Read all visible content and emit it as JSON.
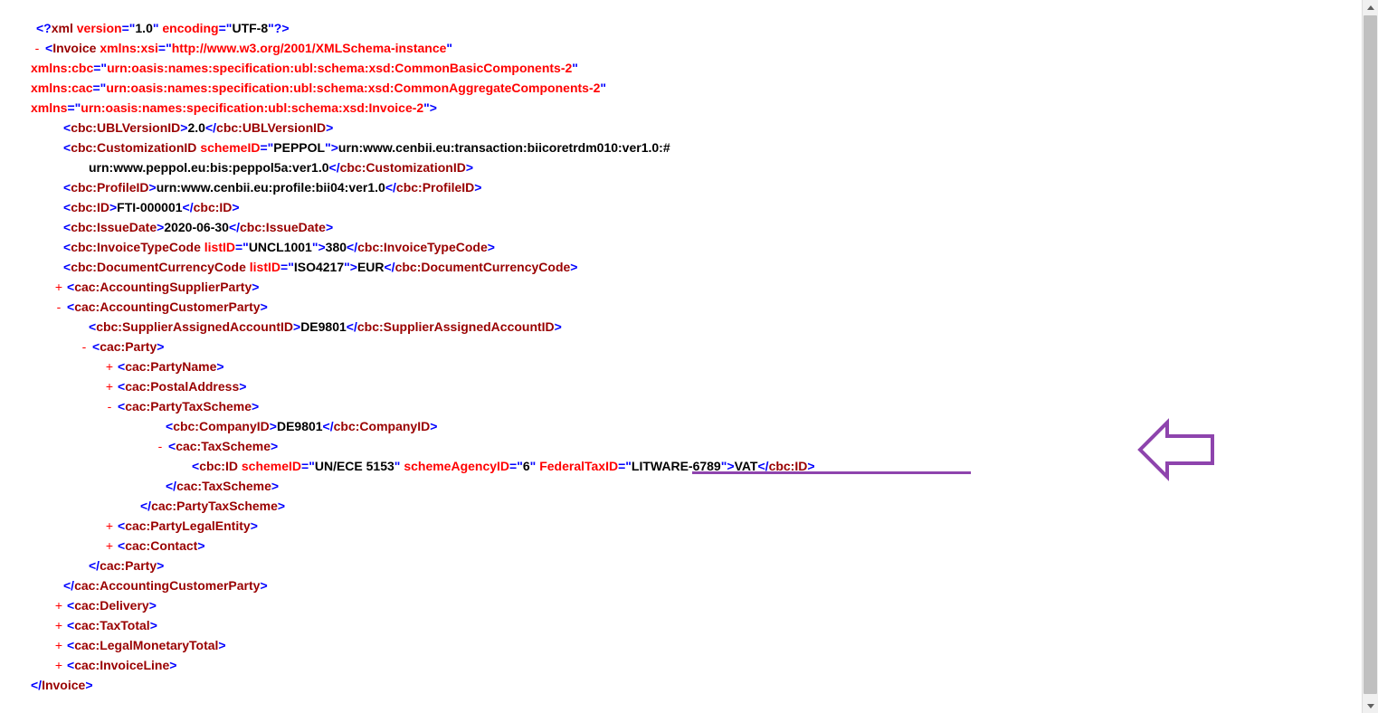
{
  "xmldecl": {
    "version": "1.0",
    "encoding": "UTF-8"
  },
  "root": {
    "name": "Invoice",
    "ns": {
      "xsi": "http://www.w3.org/2001/XMLSchema-instance",
      "cbc": "urn:oasis:names:specification:ubl:schema:xsd:CommonBasicComponents-2",
      "cac": "urn:oasis:names:specification:ubl:schema:xsd:CommonAggregateComponents-2",
      "default": "urn:oasis:names:specification:ubl:schema:xsd:Invoice-2"
    }
  },
  "els": {
    "UBLVersionID": {
      "tag": "cbc:UBLVersionID",
      "value": "2.0"
    },
    "CustomizationID": {
      "tag": "cbc:CustomizationID",
      "attrName": "schemeID",
      "attrValue": "PEPPOL",
      "value1": "urn:www.cenbii.eu:transaction:biicoretrdm010:ver1.0:#",
      "value2": "urn:www.peppol.eu:bis:peppol5a:ver1.0"
    },
    "ProfileID": {
      "tag": "cbc:ProfileID",
      "value": "urn:www.cenbii.eu:profile:bii04:ver1.0"
    },
    "ID": {
      "tag": "cbc:ID",
      "value": "FTI-000001"
    },
    "IssueDate": {
      "tag": "cbc:IssueDate",
      "value": "2020-06-30"
    },
    "InvoiceTypeCode": {
      "tag": "cbc:InvoiceTypeCode",
      "attrName": "listID",
      "attrValue": "UNCL1001",
      "value": "380"
    },
    "DocumentCurrencyCode": {
      "tag": "cbc:DocumentCurrencyCode",
      "attrName": "listID",
      "attrValue": "ISO4217",
      "value": "EUR"
    },
    "AccountingSupplierParty": {
      "tag": "cac:AccountingSupplierParty"
    },
    "AccountingCustomerParty": {
      "tag": "cac:AccountingCustomerParty"
    },
    "SupplierAssignedAccountID": {
      "tag": "cbc:SupplierAssignedAccountID",
      "value": "DE9801"
    },
    "Party": {
      "tag": "cac:Party"
    },
    "PartyName": {
      "tag": "cac:PartyName"
    },
    "PostalAddress": {
      "tag": "cac:PostalAddress"
    },
    "PartyTaxScheme": {
      "tag": "cac:PartyTaxScheme"
    },
    "CompanyID": {
      "tag": "cbc:CompanyID",
      "value": "DE9801"
    },
    "TaxScheme": {
      "tag": "cac:TaxScheme"
    },
    "TaxSchemeID": {
      "tag": "cbc:ID",
      "schemeID": "UN/ECE 5153",
      "schemeAgencyID": "6",
      "FederalTaxIDName": "FederalTaxID",
      "FederalTaxIDValue": "LITWARE-6789",
      "value": "VAT"
    },
    "PartyLegalEntity": {
      "tag": "cac:PartyLegalEntity"
    },
    "Contact": {
      "tag": "cac:Contact"
    },
    "Delivery": {
      "tag": "cac:Delivery"
    },
    "TaxTotal": {
      "tag": "cac:TaxTotal"
    },
    "LegalMonetaryTotal": {
      "tag": "cac:LegalMonetaryTotal"
    },
    "InvoiceLine": {
      "tag": "cac:InvoiceLine"
    }
  }
}
